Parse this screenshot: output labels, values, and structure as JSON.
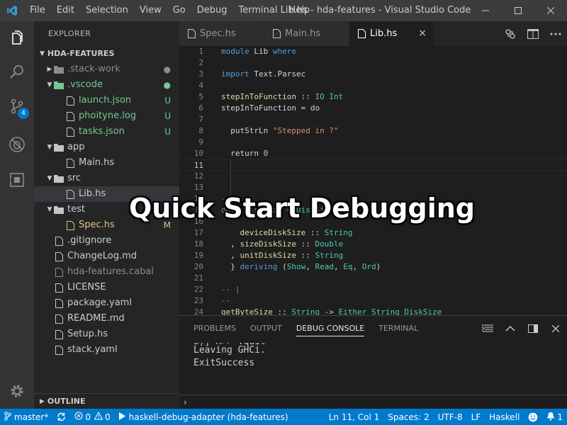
{
  "window": {
    "title": "Lib.hs - hda-features - Visual Studio Code",
    "menu": [
      "File",
      "Edit",
      "Selection",
      "View",
      "Go",
      "Debug",
      "Terminal",
      "Help"
    ]
  },
  "activity": {
    "scm_badge": "4"
  },
  "sidebar": {
    "header": "EXPLORER",
    "folder": "HDA-FEATURES",
    "items": [
      {
        "label": ".stack-work",
        "deco": "dot"
      },
      {
        "label": ".vscode",
        "deco": "dot"
      },
      {
        "label": "launch.json",
        "deco": "U"
      },
      {
        "label": "phoityne.log",
        "deco": "U"
      },
      {
        "label": "tasks.json",
        "deco": "U"
      },
      {
        "label": "app",
        "deco": ""
      },
      {
        "label": "Main.hs",
        "deco": ""
      },
      {
        "label": "src",
        "deco": ""
      },
      {
        "label": "Lib.hs",
        "deco": ""
      },
      {
        "label": "test",
        "deco": ""
      },
      {
        "label": "Spec.hs",
        "deco": "M"
      },
      {
        "label": ".gitignore",
        "deco": ""
      },
      {
        "label": "ChangeLog.md",
        "deco": ""
      },
      {
        "label": "hda-features.cabal",
        "deco": ""
      },
      {
        "label": "LICENSE",
        "deco": ""
      },
      {
        "label": "package.yaml",
        "deco": ""
      },
      {
        "label": "README.md",
        "deco": ""
      },
      {
        "label": "Setup.hs",
        "deco": ""
      },
      {
        "label": "stack.yaml",
        "deco": ""
      }
    ],
    "outline": "OUTLINE"
  },
  "tabs": [
    {
      "label": "Spec.hs"
    },
    {
      "label": "Main.hs"
    },
    {
      "label": "Lib.hs",
      "close": "×"
    }
  ],
  "editor": {
    "line_numbers": [
      "1",
      "2",
      "3",
      "4",
      "5",
      "6",
      "7",
      "8",
      "9",
      "10",
      "11",
      "12",
      "13",
      "14",
      "15",
      "16",
      "17",
      "18",
      "19",
      "20",
      "21",
      "22",
      "23",
      "24"
    ],
    "code": {
      "l1_kw": "module",
      "l1_name": " Lib ",
      "l1_where": "where",
      "l3_kw": "import",
      "l3_mod": " Text.Parsec",
      "l5_fn": "stepInToFunction",
      "l5_op": " :: ",
      "l5_t1": "IO",
      "l5_t2": " Int",
      "l6": "stepInToFunction = do",
      "l8_fn": "  putStrLn ",
      "l8_str": "\"Stepped in ?\"",
      "l10_kw": "  return ",
      "l10_num": "0",
      "l14_cm": "-- |",
      "l15_a": "data",
      "l15_b": " DiskSize = DiskSize {",
      "l17_a": "    deviceDiskSize",
      "l17_b": " :: ",
      "l17_c": "String",
      "l18_a": "  , sizeDiskSize",
      "l18_b": " :: ",
      "l18_c": "Double",
      "l19_a": "  , unitDiskSize",
      "l19_b": " :: ",
      "l19_c": "String",
      "l20_a": "  } ",
      "l20_b": "deriving",
      "l20_c": " (",
      "l20_d": "Show",
      "l20_e": ", ",
      "l20_f": "Read",
      "l20_g": ", ",
      "l20_h": "Eq",
      "l20_i": ", ",
      "l20_j": "Ord",
      "l20_k": ")",
      "l22_cm": "-- |",
      "l23_cm": "--",
      "l24_a": "getByteSize",
      "l24_b": " :: ",
      "l24_c": "String",
      "l24_d": " -> ",
      "l24_e": "Either String DiskSize"
    }
  },
  "overlay_title": "Quick Start Debugging",
  "panel": {
    "tabs": [
      "PROBLEMS",
      "OUTPUT",
      "DEBUG CONSOLE",
      "TERMINAL"
    ],
    "console": [
      "Leaving GHCi.",
      "ExitSuccess"
    ],
    "console_cut": "S)] λ>> :quit",
    "prompt": "›"
  },
  "statusbar": {
    "branch": "master*",
    "errors": "0",
    "warnings": "0",
    "debug": "haskell-debug-adapter (hda-features)",
    "position": "Ln 11, Col 1",
    "spaces": "Spaces: 2",
    "encoding": "UTF-8",
    "eol": "LF",
    "language": "Haskell",
    "notifications": "1",
    "color": "#007acc"
  }
}
